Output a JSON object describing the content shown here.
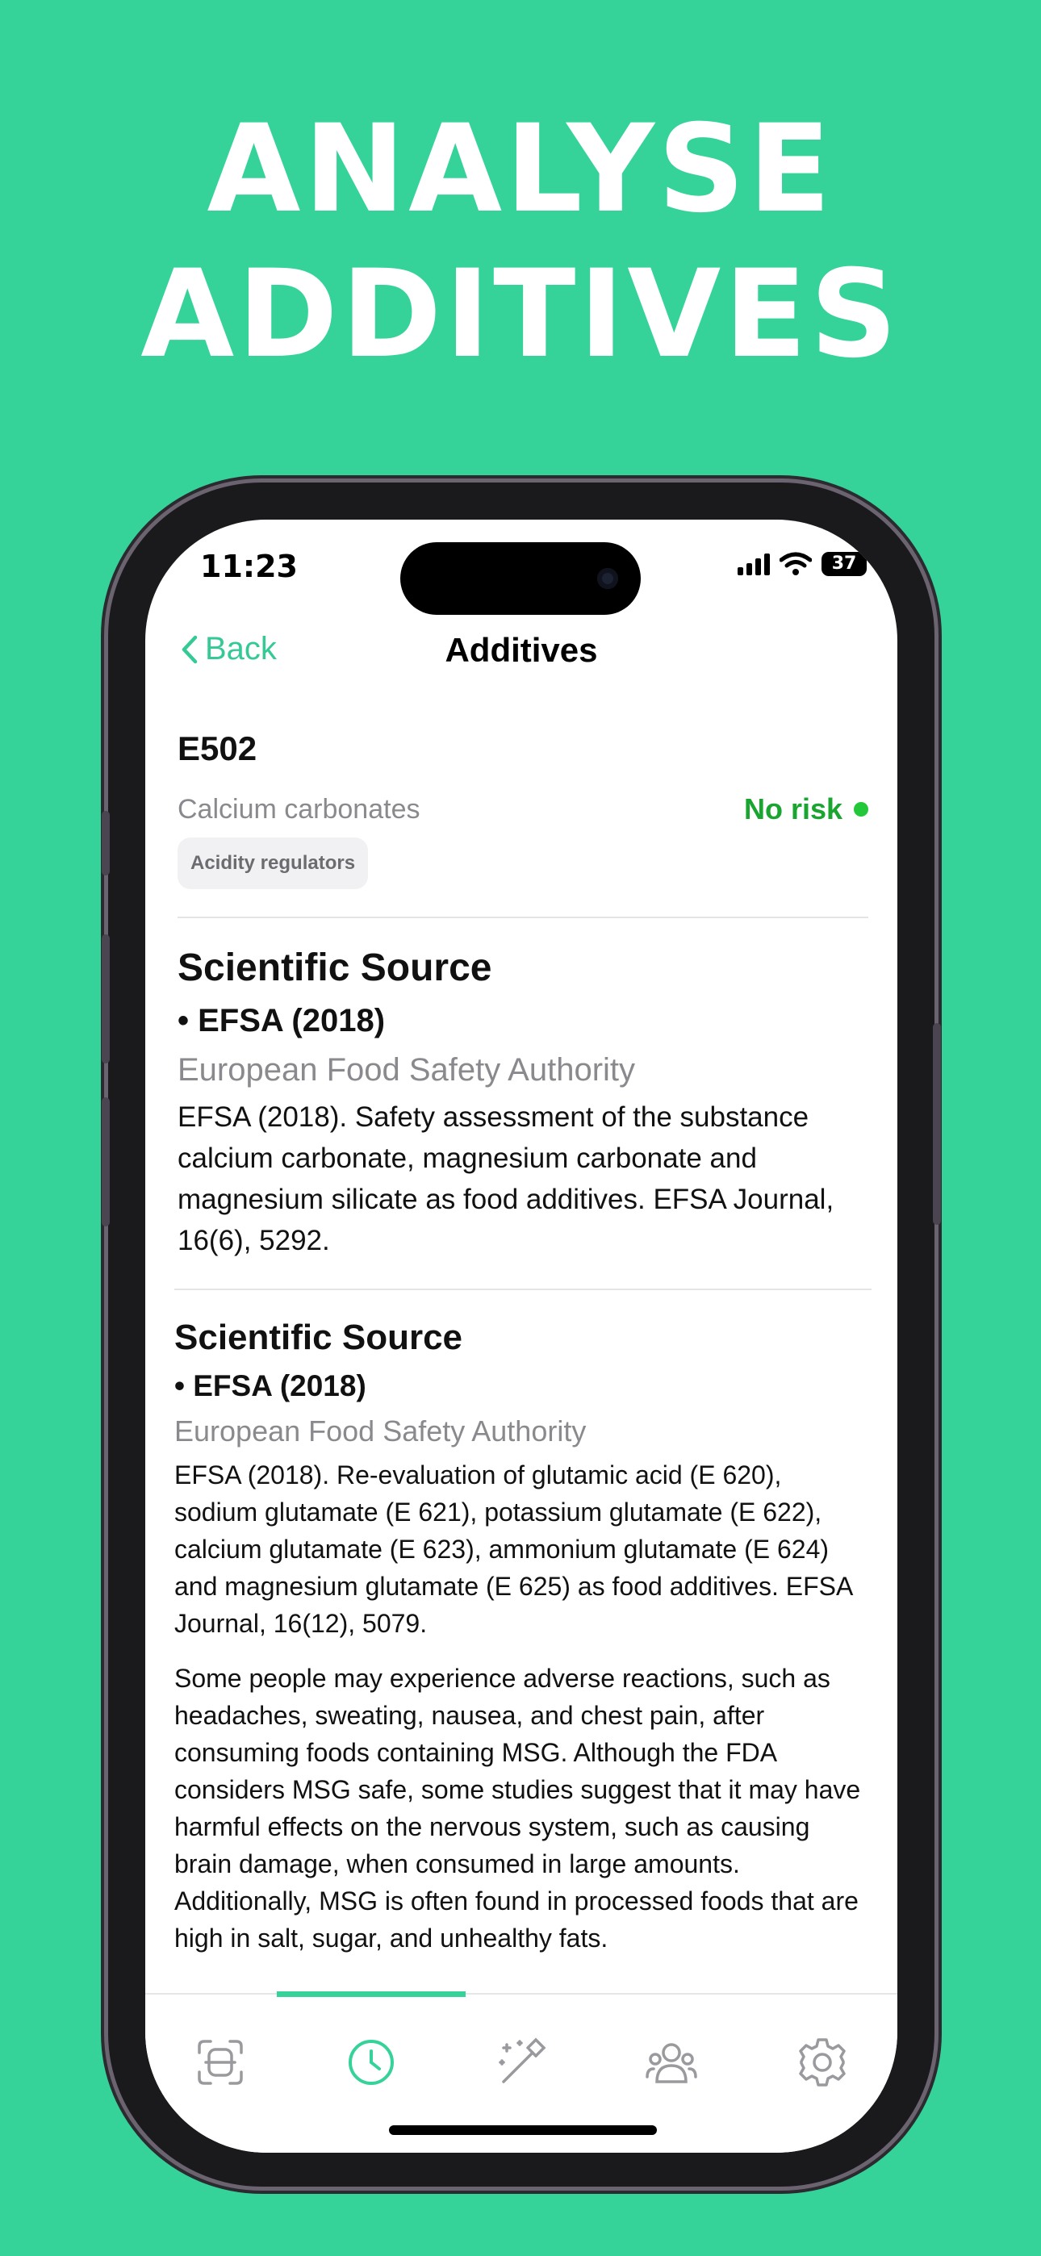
{
  "headline": {
    "line1": "ANALYSE",
    "line2": "ADDITIVES"
  },
  "status_bar": {
    "time": "11:23",
    "battery": "37"
  },
  "nav": {
    "back_label": "Back",
    "title": "Additives"
  },
  "additive": {
    "code": "E502",
    "name": "Calcium carbonates",
    "risk_label": "No risk",
    "risk_color": "#1aa531",
    "category": "Acidity regulators"
  },
  "sources": [
    {
      "title": "Scientific Source",
      "item": "• EFSA (2018)",
      "organization": "European Food Safety Authority",
      "citation": "EFSA (2018). Safety assessment of the substance calcium carbonate, magnesium carbonate and magnesium silicate as food additives. EFSA Journal, 16(6), 5292."
    },
    {
      "title": "Scientific Source",
      "item": "• EFSA (2018)",
      "organization": "European Food Safety Authority",
      "citation": "EFSA (2018). Re-evaluation of glutamic acid (E 620), sodium glutamate (E 621), potassium glutamate (E 622), calcium glutamate (E 623), ammonium glutamate (E 624) and magnesium glutamate (E 625) as food additives. EFSA Journal, 16(12), 5079.",
      "note": "Some people may experience adverse reactions, such as headaches, sweating, nausea, and chest pain, after consuming foods containing MSG. Although the FDA considers MSG safe, some studies suggest that it may have harmful effects on the nervous system, such as causing brain damage, when consumed in large amounts. Additionally, MSG is often found in processed foods that are high in salt, sugar, and unhealthy fats."
    }
  ],
  "tabbar": {
    "tabs": [
      "scan-icon",
      "history-icon",
      "magic-wand-icon",
      "community-icon",
      "settings-icon"
    ],
    "active_index": 1,
    "accent": "#35d39a"
  }
}
